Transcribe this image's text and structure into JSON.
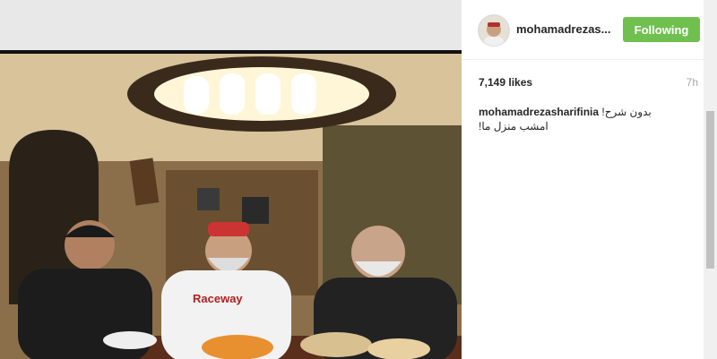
{
  "post": {
    "username": "mohamadrezas...",
    "follow_label": "Following",
    "likes": "7,149 likes",
    "time": "7h",
    "caption_user": "mohamadrezasharifinia",
    "caption_line1": "!بدون شرح",
    "caption_line2": "!امشب منزل ما"
  },
  "photo_shirt_text": "Raceway",
  "colors": {
    "follow_button": "#70c050",
    "text_primary": "#262626",
    "text_muted": "#a5a7aa"
  }
}
